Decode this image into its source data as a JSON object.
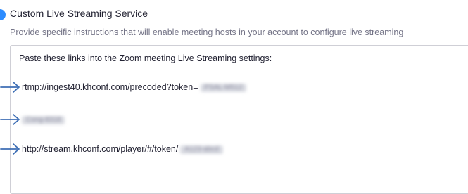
{
  "setting": {
    "title": "Custom Live Streaming Service",
    "description": "Provide specific instructions that will enable meeting hosts in your account to configure live streaming"
  },
  "instructions": {
    "intro": "Paste these links into the Zoom meeting Live Streaming settings:",
    "rtmp_prefix": "rtmp://ingest40.khconf.com/precoded?token=",
    "rtmp_token_redacted": "PSAL-M512",
    "stream_key_redacted": "Cong-8318",
    "player_prefix": "http://stream.khconf.com/player/#/token/",
    "player_token_redacted": "A123-abcd"
  },
  "colors": {
    "radio_selected": "#2d8cff",
    "annotation_arrow": "#3f6fb5",
    "box_border": "#cfcfd6"
  },
  "icons": {
    "radio": "radio-selected-icon",
    "annotation": "arrow-right-icon"
  }
}
